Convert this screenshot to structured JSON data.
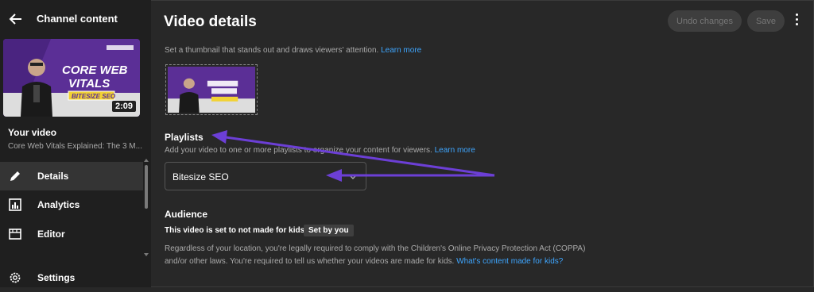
{
  "sidebar": {
    "title": "Channel content",
    "video": {
      "duration": "2:09",
      "heading": "Your video",
      "title": "Core Web Vitals Explained: The 3 M..."
    },
    "nav": [
      {
        "label": "Details",
        "icon": "pencil-icon"
      },
      {
        "label": "Analytics",
        "icon": "analytics-icon"
      },
      {
        "label": "Editor",
        "icon": "editor-icon"
      },
      {
        "label": "Settings",
        "icon": "gear-icon"
      }
    ]
  },
  "header": {
    "title": "Video details",
    "undo_label": "Undo changes",
    "save_label": "Save"
  },
  "thumbnail": {
    "description": "Set a thumbnail that stands out and draws viewers' attention.",
    "learn_more": "Learn more",
    "line1": "CORE WEB",
    "line2": "VITALS",
    "badge": "BITESIZE SEO"
  },
  "playlists": {
    "heading": "Playlists",
    "description": "Add your video to one or more playlists to organize your content for viewers.",
    "learn_more": "Learn more",
    "selected": "Bitesize SEO"
  },
  "audience": {
    "heading": "Audience",
    "status": "This video is set to not made for kids",
    "badge": "Set by you",
    "legal": "Regardless of your location, you're legally required to comply with the Children's Online Privacy Protection Act (COPPA) and/or other laws. You're required to tell us whether your videos are made for kids.",
    "link": "What's content made for kids?"
  },
  "colors": {
    "background": "#282828",
    "sidebar": "#1f1f1f",
    "link": "#3ea6ff",
    "annotation_arrow": "#6c3fd6",
    "thumbnail_purple": "#5b2f96"
  }
}
